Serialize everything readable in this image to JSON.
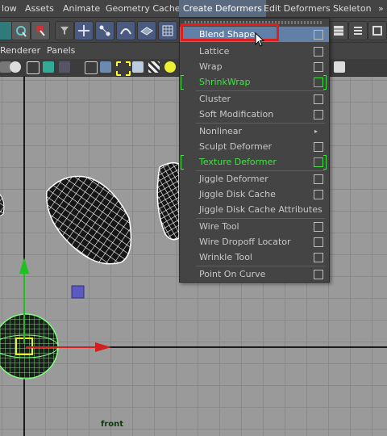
{
  "menubar": {
    "items": [
      "low",
      "Assets",
      "Animate",
      "Geometry Cache",
      "Create Deformers",
      "Edit Deformers",
      "Skeleton",
      "»"
    ]
  },
  "panel_menu": {
    "items": [
      "Renderer",
      "Panels"
    ]
  },
  "viewport": {
    "camera_label": "front"
  },
  "deformers_menu": {
    "items": [
      {
        "label": "Blend Shape",
        "option": true
      },
      {
        "label": "Lattice",
        "option": true
      },
      {
        "label": "Wrap",
        "option": true
      },
      {
        "label": "ShrinkWrap",
        "option": true
      },
      {
        "label": "Cluster",
        "option": true
      },
      {
        "label": "Soft Modification",
        "option": true
      },
      {
        "label": "Nonlinear",
        "submenu_icon": "▸"
      },
      {
        "label": "Sculpt Deformer",
        "option": true
      },
      {
        "label": "Texture Deformer",
        "option": true
      },
      {
        "label": "Jiggle Deformer",
        "option": true
      },
      {
        "label": "Jiggle Disk Cache",
        "option": true
      },
      {
        "label": "Jiggle Disk Cache Attributes"
      },
      {
        "label": "Wire Tool",
        "option": true
      },
      {
        "label": "Wire Dropoff Locator",
        "option": true
      },
      {
        "label": "Wrinkle Tool",
        "option": true
      },
      {
        "label": "Point On Curve",
        "option": true
      }
    ]
  },
  "colors": {
    "menu_bg": "#444444",
    "highlight": "#6080a8",
    "green_item": "#42e242",
    "annotation_red": "#e21d1d",
    "viewport_bg": "#9a9a9a"
  }
}
